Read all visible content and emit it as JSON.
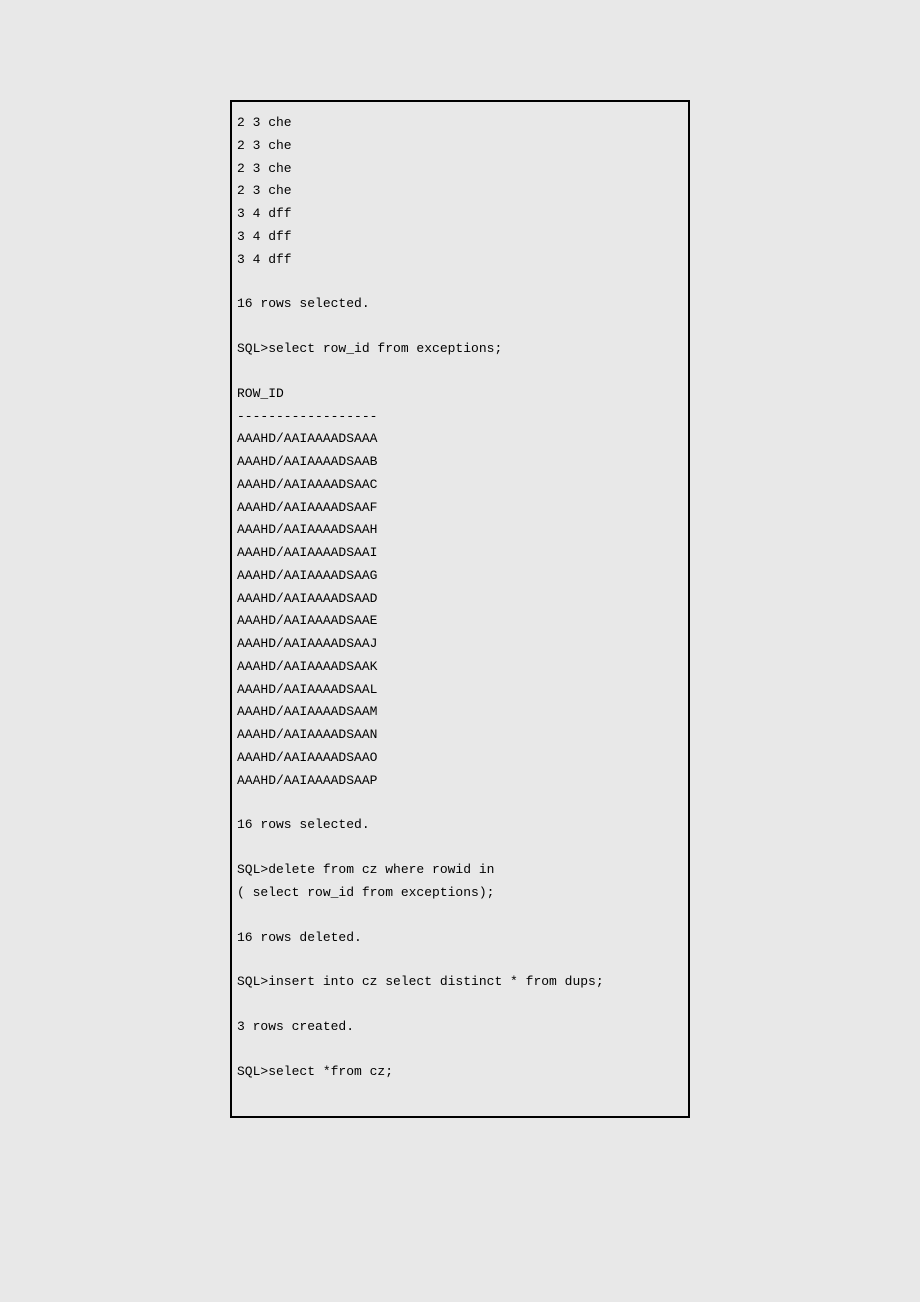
{
  "terminal": {
    "block1_rows": [
      "2 3 che",
      "2 3 che",
      "2 3 che",
      "2 3 che",
      "3 4 dff",
      "3 4 dff",
      "3 4 dff"
    ],
    "block1_footer": "16 rows selected.",
    "query1": "SQL>select row_id from exceptions;",
    "query1_header": "ROW_ID",
    "query1_divider": "------------------",
    "query1_rows": [
      "AAAHD/AAIAAAADSAAA",
      "AAAHD/AAIAAAADSAAB",
      "AAAHD/AAIAAAADSAAC",
      "AAAHD/AAIAAAADSAAF",
      "AAAHD/AAIAAAADSAAH",
      "AAAHD/AAIAAAADSAAI",
      "AAAHD/AAIAAAADSAAG",
      "AAAHD/AAIAAAADSAAD",
      "AAAHD/AAIAAAADSAAE",
      "AAAHD/AAIAAAADSAAJ",
      "AAAHD/AAIAAAADSAAK",
      "AAAHD/AAIAAAADSAAL",
      "AAAHD/AAIAAAADSAAM",
      "AAAHD/AAIAAAADSAAN",
      "AAAHD/AAIAAAADSAAO",
      "AAAHD/AAIAAAADSAAP"
    ],
    "query1_footer": "16 rows selected.",
    "query2_line1": "SQL>delete from cz where rowid in",
    "query2_line2": "( select row_id from exceptions);",
    "query2_footer": "16 rows deleted.",
    "query3": "SQL>insert into cz select distinct * from dups;",
    "query3_footer": "3 rows created.",
    "query4": "SQL>select *from cz;"
  }
}
